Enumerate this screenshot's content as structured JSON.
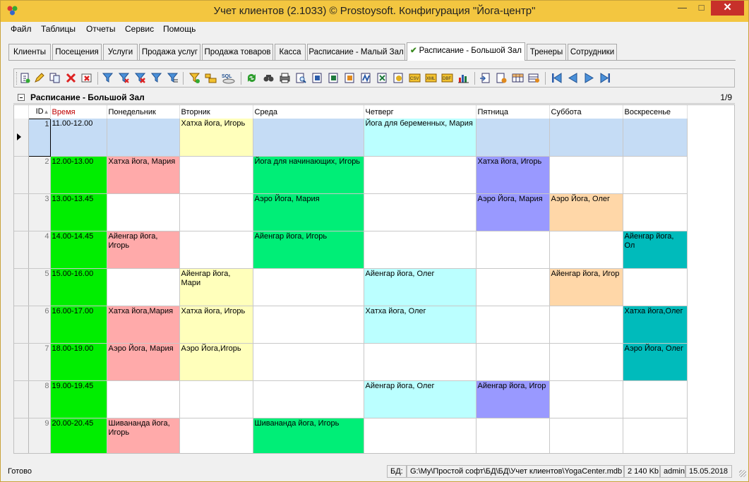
{
  "window": {
    "title": "Учет клиентов (2.1033) © Prostoysoft. Конфигурация \"Йога-центр\"",
    "minimize": "—",
    "maximize": "□",
    "close": "✕"
  },
  "menu": [
    "Файл",
    "Таблицы",
    "Отчеты",
    "Сервис",
    "Помощь"
  ],
  "tabs": [
    "Клиенты",
    "Посещения",
    "Услуги",
    "Продажа услуг",
    "Продажа товаров",
    "Касса",
    "Расписание - Малый Зал",
    "Расписание - Большой Зал",
    "Тренеры",
    "Сотрудники"
  ],
  "active_tab_check": "✔",
  "panel": {
    "title": "Расписание - Большой Зал",
    "page": "1/9"
  },
  "grid": {
    "columns": {
      "id": "ID",
      "sort": "▲",
      "time": "Время",
      "mon": "Понедельник",
      "tue": "Вторник",
      "wed": "Среда",
      "thu": "Четверг",
      "fri": "Пятница",
      "sat": "Суббота",
      "sun": "Воскресенье"
    },
    "rows": [
      {
        "id": "1",
        "time": "11.00-12.00",
        "mon": "",
        "tue": "Хатха йога, Игорь",
        "wed": "",
        "thu": "Йога для беременных, Мария",
        "fri": "",
        "sat": "",
        "sun": ""
      },
      {
        "id": "2",
        "time": "12.00-13.00",
        "mon": "Хатха йога, Мария",
        "tue": "",
        "wed": "Йога для начинающих, Игорь",
        "thu": "",
        "fri": "Хатха йога, Игорь",
        "sat": "",
        "sun": ""
      },
      {
        "id": "3",
        "time": "13.00-13.45",
        "mon": "",
        "tue": "",
        "wed": "Аэро Йога, Мария",
        "thu": "",
        "fri": "Аэро Йога, Мария",
        "sat": "Аэро Йога, Олег",
        "sun": ""
      },
      {
        "id": "4",
        "time": "14.00-14.45",
        "mon": "Айенгар йога, Игорь",
        "tue": "",
        "wed": "Айенгар йога, Игорь",
        "thu": "",
        "fri": "",
        "sat": "",
        "sun": "Айенгар йога, Ол"
      },
      {
        "id": "5",
        "time": "15.00-16.00",
        "mon": "",
        "tue": "Айенгар йога, Мари",
        "wed": "",
        "thu": "Айенгар йога, Олег",
        "fri": "",
        "sat": "Айенгар йога, Игор",
        "sun": ""
      },
      {
        "id": "6",
        "time": "16.00-17.00",
        "mon": "Хатха йога,Мария",
        "tue": "Хатха йога, Игорь",
        "wed": "",
        "thu": "Хатха йога, Олег",
        "fri": "",
        "sat": "",
        "sun": "Хатха йога,Олег"
      },
      {
        "id": "7",
        "time": "18.00-19.00",
        "mon": "Аэро Йога, Мария",
        "tue": "Аэро Йога,Игорь",
        "wed": "",
        "thu": "",
        "fri": "",
        "sat": "",
        "sun": "Аэро Йога, Олег"
      },
      {
        "id": "8",
        "time": "19.00-19.45",
        "mon": "",
        "tue": "",
        "wed": "",
        "thu": "Айенгар йога, Олег",
        "fri": "Айенгар йога, Игор",
        "sat": "",
        "sun": ""
      },
      {
        "id": "9",
        "time": "20.00-20.45",
        "mon": "Шивананда йога, Игорь",
        "tue": "",
        "wed": "Шивананда йога, Игорь",
        "thu": "",
        "fri": "",
        "sat": "",
        "sun": ""
      }
    ],
    "colors": {
      "selected_row": "#c5dcf5",
      "time": "#00ee00",
      "mon": "#ffaaaa",
      "tue": "#ffffbb",
      "wed": "#00ee77",
      "thu": "#bbffff",
      "fri": "#9999ff",
      "sat": "#ffd7a8",
      "sun": "#00bbbb"
    }
  },
  "status": {
    "ready": "Готово",
    "db_label": "БД:",
    "db_path": "G:\\My\\Простой софт\\БД\\БД\\Учет клиентов\\YogaCenter.mdb",
    "size": "2 140 Kb",
    "user": "admin",
    "date": "15.05.2018"
  },
  "toolbar_icons": [
    "add-icon",
    "edit-icon",
    "copy-icon",
    "delete-icon",
    "delete-all-icon",
    "filter-icon",
    "filter-remove-icon",
    "filter-clear-icon",
    "filter-edit-icon",
    "filter-by-selection-icon",
    "filter-advanced-icon",
    "group-icon",
    "sql-icon",
    "refresh-icon",
    "find-icon",
    "print-icon",
    "preview-icon",
    "export-word-icon",
    "export-excel-icon",
    "export-html-icon",
    "export-rtf-icon",
    "export-xls-icon",
    "export-text-icon",
    "export-csv-icon",
    "export-xml-icon",
    "export-dbf-icon",
    "chart-icon",
    "import-icon",
    "import-file-icon",
    "columns-icon",
    "settings-icon",
    "first-record-icon",
    "prev-record-icon",
    "next-record-icon",
    "last-record-icon"
  ]
}
